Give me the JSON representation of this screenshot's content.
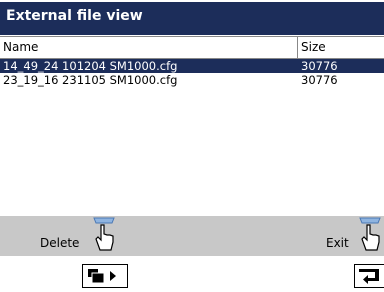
{
  "window": {
    "title": "External file view"
  },
  "table": {
    "columns": [
      "Name",
      "Size"
    ],
    "rows": [
      {
        "name": "14_49_24 101204 SM1000.cfg",
        "size": "30776",
        "selected": true
      },
      {
        "name": "23_19_16 231105 SM1000.cfg",
        "size": "30776",
        "selected": false
      }
    ]
  },
  "softkeys": {
    "left_label": "Delete",
    "right_label": "Exit"
  },
  "colors": {
    "title_bar": "#1c2d5a",
    "selection": "#1c2d5a",
    "softkey_bar": "#c8c8c8"
  },
  "icons": [
    "hand-pointer-icon",
    "page-forward-icon",
    "return-icon"
  ]
}
